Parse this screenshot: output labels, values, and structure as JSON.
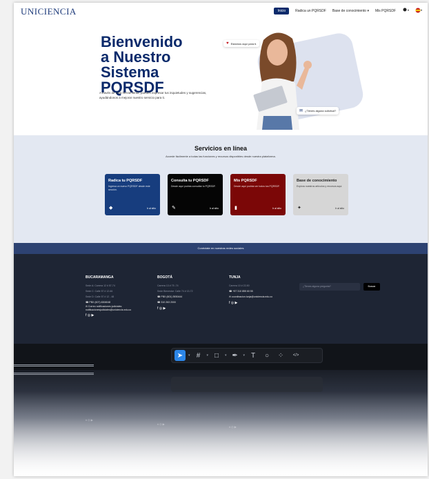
{
  "nav": {
    "logo": "UNICIENCIA",
    "links": [
      "Inicio",
      "Radica un PQRSDF",
      "Base de conocimiento",
      "Mis PQRSDF"
    ],
    "dropdown_glyph": "▾"
  },
  "hero": {
    "title_lines": [
      "Bienvenido",
      "a Nuestro",
      "Sistema PQRSDF"
    ],
    "description": "A través de esta herramienta, puedes expresar tus inquietudes y sugerencias, ayudándonos a mejorar nuestro servicio para ti.",
    "chip_top": "Estamos aquí para ti.",
    "chip_bottom": "¿Tienes alguna solicitud?"
  },
  "services": {
    "title": "Servicios en línea",
    "subtitle": "Accede fácilmente a todas las funciones y recursos disponibles desde nuestra plataforma.",
    "cards": [
      {
        "title": "Radica tu PQRSDF",
        "desc": "Ingresa un nuevo PQRSDF desde este sección.",
        "icon": "tag-icon",
        "link": "Ir al sitio"
      },
      {
        "title": "Consulta tu PQRSDF",
        "desc": "Desde aquí podrás consultar tu PQRSDF.",
        "icon": "edit-icon",
        "link": "Ir al sitio"
      },
      {
        "title": "Mis PQRSDF",
        "desc": "Desde aquí podrás ver todos tus PQRSDF.",
        "icon": "document-icon",
        "link": "Ir al sitio"
      },
      {
        "title": "Base de conocimiento",
        "desc": "Explora nuestros artículos y recursos aquí.",
        "icon": "bulb-icon",
        "link": "Ir al sitio"
      }
    ]
  },
  "social_band": "Conéctate en nuestras redes sociales",
  "footer": {
    "cols": [
      {
        "heading": "BUCARAMANGA",
        "lines": [
          "Sede A: Carrera 12 # 57-74",
          "Sede C: Calle 57 # 12-66",
          "Sede D: Calle 57 # 12 - 48"
        ],
        "phone": "PBX (607) 6306048",
        "email": "Correo notificaciones judiciales: notificacionesjudiciales@uniciencia.edu.co"
      },
      {
        "heading": "BOGOTÁ",
        "lines": [
          "Carrera 13 # 75 -74",
          "Sede Bienestar: Calle 74 # 13-72"
        ],
        "phone": "PBX (601) 3930444",
        "phone2": "310 263 2000"
      },
      {
        "heading": "TUNJA",
        "lines": [
          "Carrera 10 # 22-50"
        ],
        "phone": "+57 310 855 60 55",
        "email": "coordinacion.tunja@uniciencia.edu.co"
      }
    ],
    "question_placeholder": "¿Tienes alguna pregunta?",
    "search_button": "Buscar"
  },
  "toolbar": {
    "code_label": "</>"
  }
}
